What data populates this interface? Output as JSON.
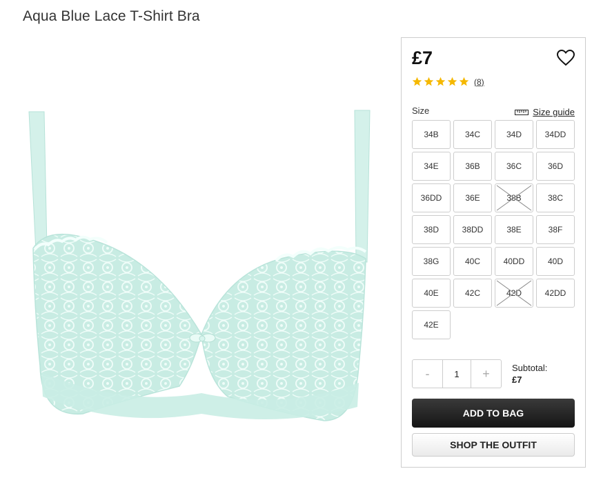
{
  "product": {
    "title": "Aqua Blue Lace T-Shirt Bra",
    "image_alt": "Aqua blue lace t-shirt bra"
  },
  "panel": {
    "price": "£7",
    "rating_stars": 5,
    "review_count": "(8)",
    "size_label": "Size",
    "size_guide_label": "Size guide",
    "sizes": [
      {
        "label": "34B",
        "available": true
      },
      {
        "label": "34C",
        "available": true
      },
      {
        "label": "34D",
        "available": true
      },
      {
        "label": "34DD",
        "available": true
      },
      {
        "label": "34E",
        "available": true
      },
      {
        "label": "36B",
        "available": true
      },
      {
        "label": "36C",
        "available": true
      },
      {
        "label": "36D",
        "available": true
      },
      {
        "label": "36DD",
        "available": true
      },
      {
        "label": "36E",
        "available": true
      },
      {
        "label": "38B",
        "available": false
      },
      {
        "label": "38C",
        "available": true
      },
      {
        "label": "38D",
        "available": true
      },
      {
        "label": "38DD",
        "available": true
      },
      {
        "label": "38E",
        "available": true
      },
      {
        "label": "38F",
        "available": true
      },
      {
        "label": "38G",
        "available": true
      },
      {
        "label": "40C",
        "available": true
      },
      {
        "label": "40DD",
        "available": true
      },
      {
        "label": "40D",
        "available": true
      },
      {
        "label": "40E",
        "available": true
      },
      {
        "label": "42C",
        "available": true
      },
      {
        "label": "42D",
        "available": false
      },
      {
        "label": "42DD",
        "available": true
      },
      {
        "label": "42E",
        "available": true
      }
    ],
    "quantity": {
      "minus": "-",
      "value": "1",
      "plus": "+"
    },
    "subtotal_label": "Subtotal:",
    "subtotal_value": "£7",
    "add_to_bag": "ADD TO BAG",
    "shop_outfit": "SHOP THE OUTFIT"
  },
  "colors": {
    "star": "#f5b800",
    "bra": "#cdeee6",
    "lace": "#e8faf5"
  }
}
